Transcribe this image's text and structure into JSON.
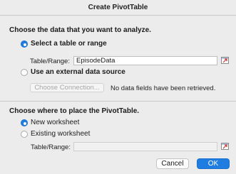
{
  "window": {
    "title": "Create PivotTable"
  },
  "source": {
    "heading": "Choose the data that you want to analyze.",
    "table_option": {
      "label": "Select a table or range",
      "selected": true
    },
    "range_label": "Table/Range:",
    "range_value": "EpisodeData",
    "external_option": {
      "label": "Use an external data source",
      "selected": false
    },
    "connection_button": "Choose Connection...",
    "connection_status": "No data fields have been retrieved."
  },
  "placement": {
    "heading": "Choose where to place the PivotTable.",
    "new_option": {
      "label": "New worksheet",
      "selected": true
    },
    "existing_option": {
      "label": "Existing worksheet",
      "selected": false
    },
    "range_label": "Table/Range:",
    "range_value": ""
  },
  "buttons": {
    "cancel": "Cancel",
    "ok": "OK"
  },
  "colors": {
    "accent": "#1f7ce0",
    "background": "#ececec"
  },
  "icons": {
    "range_selector": "collapse-dialog-icon"
  }
}
